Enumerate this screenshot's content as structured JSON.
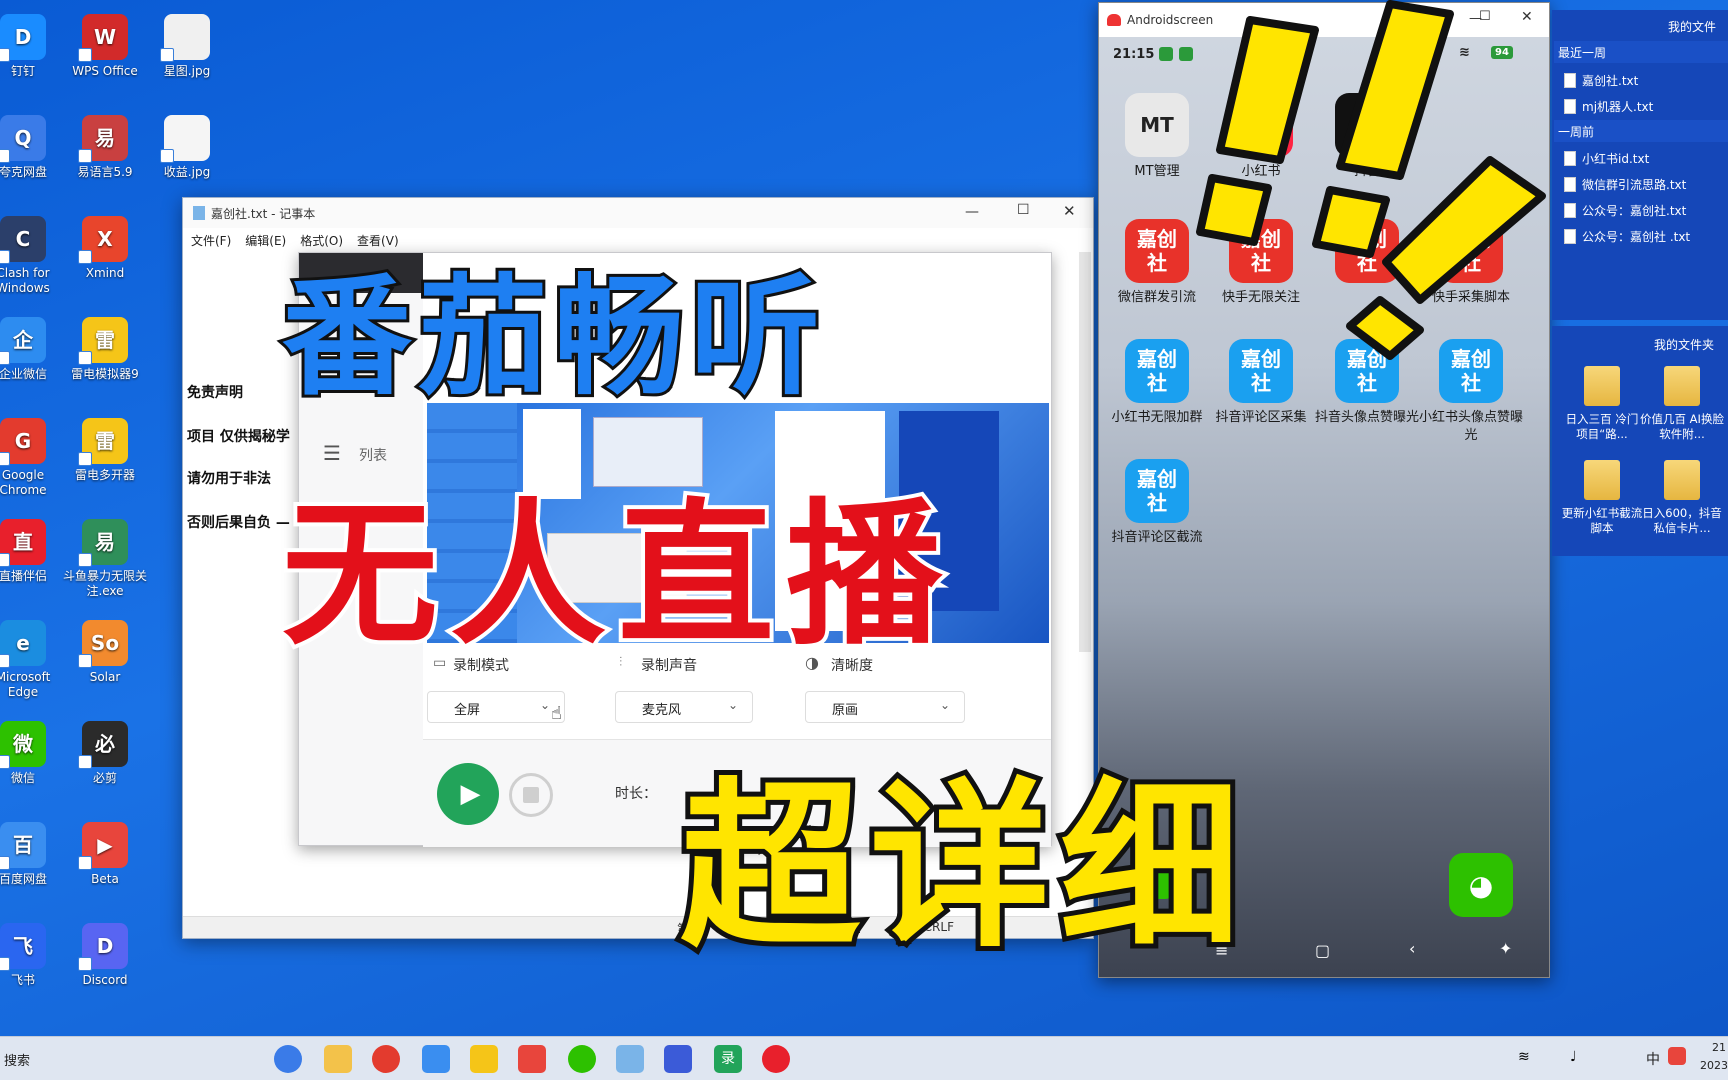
{
  "desktop": {
    "icons": [
      {
        "label": "钉钉",
        "color": "#1a8cff",
        "glyph": "D"
      },
      {
        "label": "WPS Office",
        "color": "#d22a2a",
        "glyph": "W"
      },
      {
        "label": "星图.jpg",
        "color": "#f0f0f0",
        "glyph": ""
      },
      {
        "label": "夸克网盘",
        "color": "#3a7be8",
        "glyph": "Q"
      },
      {
        "label": "易语言5.9",
        "color": "#c94040",
        "glyph": "易"
      },
      {
        "label": "收益.jpg",
        "color": "#f5f5f5",
        "glyph": ""
      },
      {
        "label": "Clash for Windows",
        "color": "#2b3f6a",
        "glyph": "C"
      },
      {
        "label": "Xmind",
        "color": "#e8452c",
        "glyph": "X"
      },
      {
        "label": "企业微信",
        "color": "#2d8cf0",
        "glyph": "企"
      },
      {
        "label": "雷电模拟器9",
        "color": "#f5c518",
        "glyph": "雷"
      },
      {
        "label": "Google Chrome",
        "color": "#e33b2e",
        "glyph": "G"
      },
      {
        "label": "雷电多开器",
        "color": "#f5c518",
        "glyph": "雷"
      },
      {
        "label": "直播伴侣",
        "color": "#e8202c",
        "glyph": "直"
      },
      {
        "label": "斗鱼暴力无限关注.exe",
        "color": "#2f8f5a",
        "glyph": "易"
      },
      {
        "label": "Microsoft Edge",
        "color": "#1b8de0",
        "glyph": "e"
      },
      {
        "label": "Solar",
        "color": "#f28a2e",
        "glyph": "So"
      },
      {
        "label": "微信",
        "color": "#2dc100",
        "glyph": "微"
      },
      {
        "label": "必剪",
        "color": "#2b2b2b",
        "glyph": "必"
      },
      {
        "label": "百度网盘",
        "color": "#3a8ef0",
        "glyph": "百"
      },
      {
        "label": "Beta",
        "color": "#e8453c",
        "glyph": "▶"
      },
      {
        "label": "飞书",
        "color": "#2a66f0",
        "glyph": "飞"
      },
      {
        "label": "Discord",
        "color": "#5865f2",
        "glyph": "D"
      }
    ]
  },
  "notepad": {
    "title": "嘉创社.txt - 记事本",
    "menu": [
      "文件(F)",
      "编辑(E)",
      "格式(O)",
      "查看(V)"
    ],
    "lines": [
      "免责声明",
      "项目 仅供揭秘学",
      "请勿用于非法",
      "否则后果自负 —"
    ],
    "status_left": "第",
    "status_right": "(CRLF"
  },
  "recorder": {
    "side_label": "列表",
    "mode_label": "录制模式",
    "mode_value": "全屏",
    "sound_label": "录制声音",
    "sound_value": "麦克风",
    "quality_label": "清晰度",
    "quality_value": "原画",
    "duration_label": "时长："
  },
  "phone": {
    "window_title": "Androidscreen",
    "time": "21:15",
    "battery": "94",
    "apps_row1": [
      {
        "label": "MT管理",
        "color": "#e8e8e8",
        "text": "MT"
      },
      {
        "label": "小红书",
        "color": "#ff2442",
        "text": "小红书"
      },
      {
        "label": "抖音",
        "color": "#111111",
        "text": "♪"
      }
    ],
    "apps_row2": [
      {
        "label": "微信群发引流",
        "color": "#e8322a"
      },
      {
        "label": "快手无限关注",
        "color": "#e8322a"
      },
      {
        "label": "",
        "color": "#e8322a"
      },
      {
        "label": "快手采集脚本",
        "color": "#e8322a"
      }
    ],
    "apps_row3": [
      {
        "label": "小红书无限加群",
        "color": "#1aa0f0"
      },
      {
        "label": "抖音评论区采集",
        "color": "#1aa0f0"
      },
      {
        "label": "抖音头像点赞曝光",
        "color": "#1aa0f0"
      },
      {
        "label": "小红书头像点赞曝光",
        "color": "#1aa0f0"
      }
    ],
    "apps_row4": [
      {
        "label": "抖音评论区截流",
        "color": "#1aa0f0"
      }
    ],
    "app_icon_text": "嘉创\n社"
  },
  "right_panel": {
    "header": "我的文件",
    "section_week": "最近一周",
    "week_files": [
      "嘉创社.txt",
      "mj机器人.txt"
    ],
    "section_before": "一周前",
    "before_files": [
      "小红书id.txt",
      "微信群引流思路.txt",
      "公众号：嘉创社.txt",
      "公众号：嘉创社 .txt"
    ],
    "header2": "我的文件夹",
    "folders": [
      "日入三百 冷门项目“路...",
      "价值几百 AI换脸软件附...",
      "更新小红书截流脚本",
      "日入600，抖音私信卡片..."
    ]
  },
  "overlay": {
    "line1": "番茄畅听",
    "line2": "无人直播",
    "line3": "超详细",
    "colors": {
      "line1": "#1e7ff2",
      "line2": "#e3101a",
      "line3": "#ffe500"
    }
  },
  "taskbar": {
    "search": "搜索",
    "ime": "中",
    "clock": "21",
    "date": "2023"
  }
}
